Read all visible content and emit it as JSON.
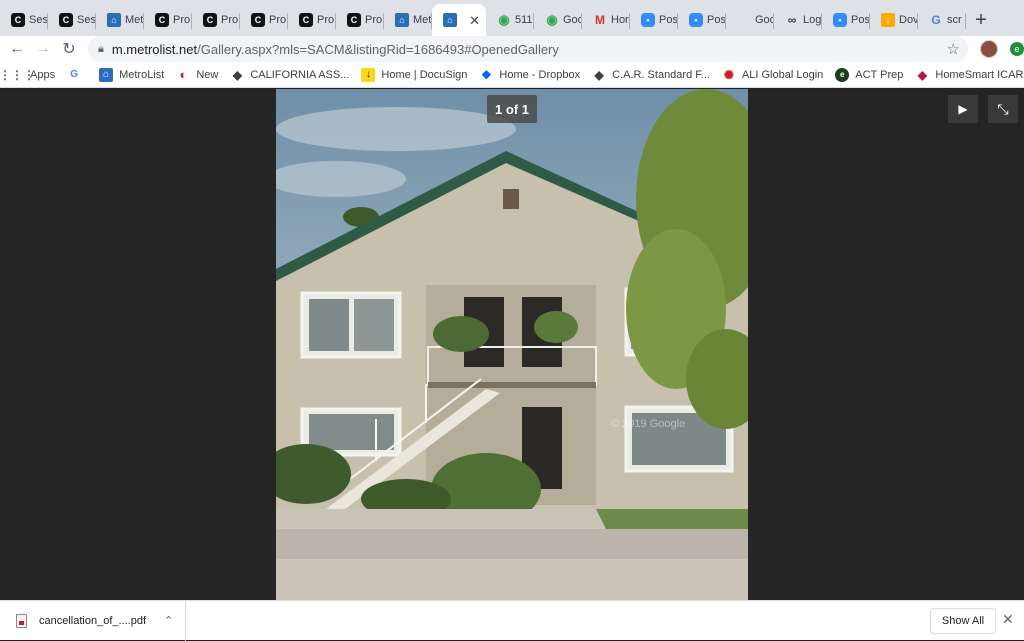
{
  "tabs": [
    {
      "icon": "c-icon",
      "glyph": "C",
      "fav": "c",
      "title": "Ses"
    },
    {
      "icon": "c-icon",
      "glyph": "C",
      "fav": "c",
      "title": "Ses"
    },
    {
      "icon": "metrolist-icon",
      "glyph": "⌂",
      "fav": "m",
      "title": "Met"
    },
    {
      "icon": "c-icon",
      "glyph": "C",
      "fav": "c",
      "title": "Pro"
    },
    {
      "icon": "c-icon",
      "glyph": "C",
      "fav": "c",
      "title": "Pro"
    },
    {
      "icon": "c-icon",
      "glyph": "C",
      "fav": "c",
      "title": "Pro"
    },
    {
      "icon": "c-icon",
      "glyph": "C",
      "fav": "c",
      "title": "Pro"
    },
    {
      "icon": "c-icon",
      "glyph": "C",
      "fav": "c",
      "title": "Pro"
    },
    {
      "icon": "metrolist-icon",
      "glyph": "⌂",
      "fav": "m",
      "title": "Met"
    },
    {
      "icon": "metrolist-icon",
      "glyph": "⌂",
      "fav": "m",
      "title": "",
      "active": true
    },
    {
      "icon": "maps-pin-icon",
      "glyph": "◉",
      "fav": "maps",
      "title": "511"
    },
    {
      "icon": "maps-pin-icon",
      "glyph": "◉",
      "fav": "maps",
      "title": "Goo"
    },
    {
      "icon": "gmail-icon",
      "glyph": "M",
      "fav": "gm",
      "title": "Hor"
    },
    {
      "icon": "zoom-icon",
      "glyph": "▪",
      "fav": "zoom",
      "title": "Pos"
    },
    {
      "icon": "zoom-icon",
      "glyph": "▪",
      "fav": "zoom",
      "title": "Pos"
    },
    {
      "icon": "blank-icon",
      "glyph": "",
      "fav": "blank",
      "title": "Goo"
    },
    {
      "icon": "link-icon",
      "glyph": "∞",
      "fav": "link",
      "title": "Log"
    },
    {
      "icon": "zoom-icon",
      "glyph": "▪",
      "fav": "zoom",
      "title": "Pos"
    },
    {
      "icon": "download-icon",
      "glyph": "↓",
      "fav": "dl",
      "title": "Dov"
    },
    {
      "icon": "google-icon",
      "glyph": "G",
      "fav": "g",
      "title": "scr"
    }
  ],
  "toolbar": {
    "url_host": "m.metrolist.net",
    "url_path": "/Gallery.aspx?mls=SACM&listingRid=1686493#OpenedGallery"
  },
  "bookmarks": [
    {
      "icon": "apps-grid-icon",
      "glyph": "⋮⋮⋮",
      "cls": "apps",
      "label": "Apps"
    },
    {
      "icon": "google-icon",
      "glyph": "G",
      "cls": "g",
      "label": ""
    },
    {
      "icon": "metrolist-icon",
      "glyph": "⌂",
      "cls": "ml",
      "label": "MetroList"
    },
    {
      "icon": "new-icon",
      "glyph": "◐",
      "cls": "new",
      "label": "New"
    },
    {
      "icon": "car-diamond-icon",
      "glyph": "◆",
      "cls": "ca",
      "label": "CALIFORNIA ASS..."
    },
    {
      "icon": "docusign-icon",
      "glyph": "↓",
      "cls": "ds",
      "label": "Home | DocuSign"
    },
    {
      "icon": "dropbox-icon",
      "glyph": "❖",
      "cls": "db",
      "label": "Home - Dropbox"
    },
    {
      "icon": "car-diamond-icon",
      "glyph": "◆",
      "cls": "ca",
      "label": "C.A.R. Standard F..."
    },
    {
      "icon": "ali-global-icon",
      "glyph": "✺",
      "cls": "ali",
      "label": "ALI Global Login"
    },
    {
      "icon": "act-prep-icon",
      "glyph": "e",
      "cls": "act",
      "label": "ACT Prep"
    },
    {
      "icon": "homesmart-icon",
      "glyph": "◆",
      "cls": "hs",
      "label": "HomeSmart ICAR..."
    }
  ],
  "gallery": {
    "counter": "1 of 1",
    "watermark": "© 2019 Google"
  },
  "download_bar": {
    "filename": "cancellation_of_....pdf",
    "show_all": "Show All"
  }
}
